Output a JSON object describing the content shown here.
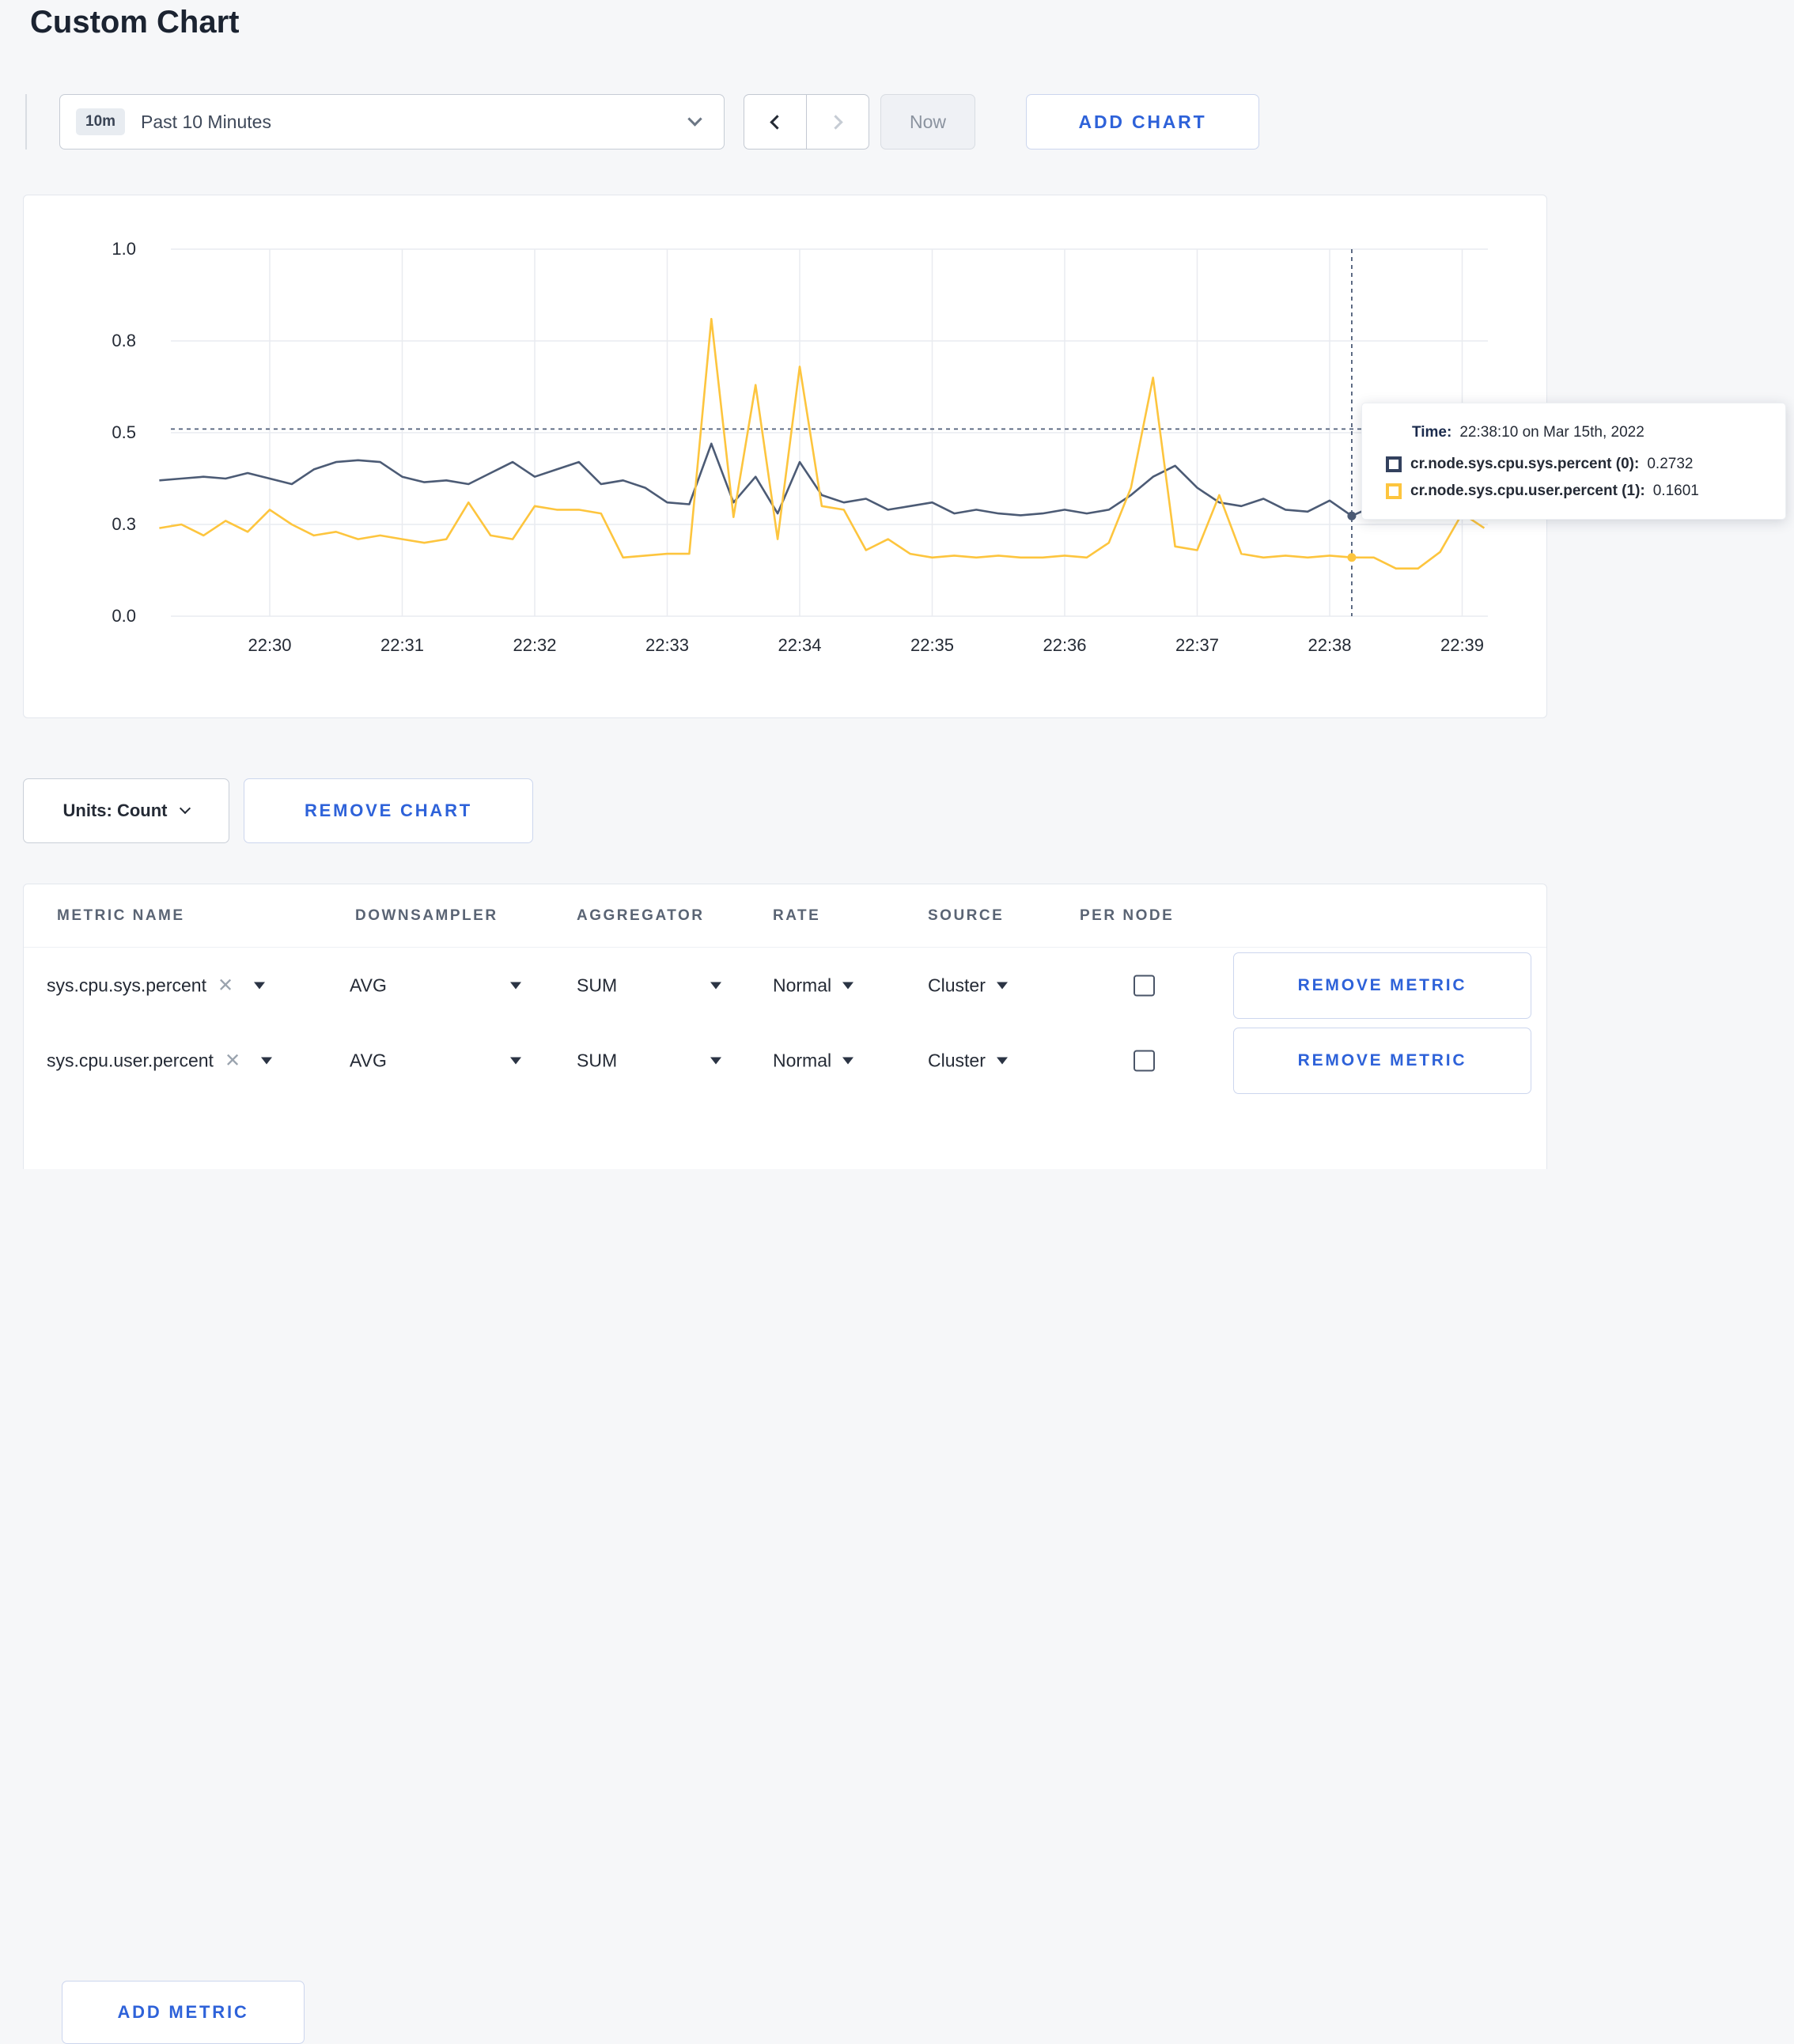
{
  "page": {
    "title": "Custom Chart",
    "background": "#f6f7f9",
    "accent": "#2e62d9"
  },
  "toolbar": {
    "range_badge": "10m",
    "range_label": "Past 10 Minutes",
    "now_label": "Now",
    "add_chart_label": "ADD CHART"
  },
  "chart_data": {
    "type": "line",
    "title": "",
    "xlabel": "",
    "ylabel": "",
    "ylim": [
      0,
      1
    ],
    "grid": true,
    "x_ticks": [
      "22:30",
      "22:31",
      "22:32",
      "22:33",
      "22:34",
      "22:35",
      "22:36",
      "22:37",
      "22:38",
      "22:39"
    ],
    "y_tick_labels": [
      "1.0",
      "0.8",
      "0.5",
      "0.3",
      "0.0"
    ],
    "y_tick_values": [
      1.0,
      0.75,
      0.5,
      0.25,
      0
    ],
    "x_start_offset_min": -0.8333333,
    "x_step_min": 0.1666667,
    "series": [
      {
        "name": "cr.node.sys.cpu.sys.percent",
        "color": "#4c5b75",
        "values": [
          0.37,
          0.375,
          0.38,
          0.375,
          0.39,
          0.375,
          0.36,
          0.4,
          0.42,
          0.425,
          0.42,
          0.38,
          0.365,
          0.37,
          0.36,
          0.39,
          0.42,
          0.38,
          0.4,
          0.42,
          0.36,
          0.37,
          0.35,
          0.31,
          0.305,
          0.47,
          0.31,
          0.38,
          0.28,
          0.42,
          0.33,
          0.31,
          0.32,
          0.29,
          0.3,
          0.31,
          0.28,
          0.29,
          0.28,
          0.275,
          0.28,
          0.29,
          0.28,
          0.29,
          0.33,
          0.38,
          0.41,
          0.35,
          0.31,
          0.3,
          0.32,
          0.29,
          0.285,
          0.315,
          0.2732,
          0.3,
          0.31,
          0.3,
          0.305,
          0.3,
          0.31
        ]
      },
      {
        "name": "cr.node.sys.cpu.user.percent",
        "color": "#fdc53e",
        "values": [
          0.24,
          0.25,
          0.22,
          0.26,
          0.23,
          0.29,
          0.25,
          0.22,
          0.23,
          0.21,
          0.22,
          0.21,
          0.2,
          0.21,
          0.31,
          0.22,
          0.21,
          0.3,
          0.29,
          0.29,
          0.28,
          0.16,
          0.165,
          0.17,
          0.17,
          0.81,
          0.27,
          0.63,
          0.21,
          0.68,
          0.3,
          0.29,
          0.18,
          0.21,
          0.17,
          0.16,
          0.165,
          0.16,
          0.165,
          0.16,
          0.16,
          0.165,
          0.16,
          0.2,
          0.35,
          0.65,
          0.19,
          0.18,
          0.33,
          0.17,
          0.16,
          0.165,
          0.16,
          0.165,
          0.1601,
          0.16,
          0.13,
          0.13,
          0.175,
          0.28,
          0.24
        ]
      }
    ],
    "crosshair": {
      "x_offset_min": 8.1666667,
      "hline_value": 0.51
    }
  },
  "tooltip": {
    "time_label": "Time:",
    "time_value": "22:38:10 on Mar 15th, 2022",
    "entries": [
      {
        "label": "cr.node.sys.cpu.sys.percent (0):",
        "value": "0.2732",
        "color": "#33415e"
      },
      {
        "label": "cr.node.sys.cpu.user.percent (1):",
        "value": "0.1601",
        "color": "#fdc53e"
      }
    ]
  },
  "chart_controls": {
    "units_label": "Units: Count",
    "remove_chart_label": "REMOVE CHART"
  },
  "metrics_table": {
    "headers": [
      "METRIC NAME",
      "DOWNSAMPLER",
      "AGGREGATOR",
      "RATE",
      "SOURCE",
      "PER NODE"
    ],
    "rows": [
      {
        "metric": "sys.cpu.sys.percent",
        "downsampler": "AVG",
        "aggregator": "SUM",
        "rate": "Normal",
        "source": "Cluster",
        "per_node_checked": false,
        "remove_label": "REMOVE METRIC"
      },
      {
        "metric": "sys.cpu.user.percent",
        "downsampler": "AVG",
        "aggregator": "SUM",
        "rate": "Normal",
        "source": "Cluster",
        "per_node_checked": false,
        "remove_label": "REMOVE METRIC"
      }
    ],
    "add_metric_label": "ADD METRIC"
  }
}
